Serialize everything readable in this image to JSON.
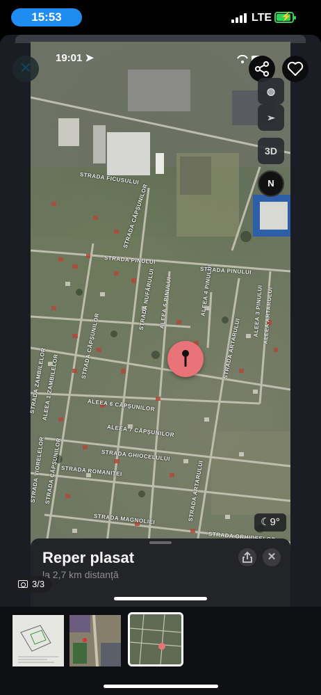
{
  "status_bar": {
    "time": "15:53",
    "carrier": "LTE",
    "battery": "charging"
  },
  "inner_screenshot": {
    "time": "19:01"
  },
  "map": {
    "controls": {
      "globe_icon": "globe-icon",
      "location_icon": "location-arrow-icon",
      "view_3d_label": "3D",
      "compass_label": "N"
    },
    "weather": {
      "icon": "moon-icon",
      "temperature": "9°"
    },
    "streets": [
      {
        "key": "ficusului",
        "name": "STRADA FICUSULUI"
      },
      {
        "key": "capsunilor_top",
        "name": "STRADA CĂPȘUNILOR"
      },
      {
        "key": "pinului_left",
        "name": "STRADA PINULUI"
      },
      {
        "key": "pinului_right",
        "name": "STRADA PINULUI"
      },
      {
        "key": "nufarului",
        "name": "STRADA NUFĂRULUI"
      },
      {
        "key": "aleea6pinului",
        "name": "ALEEA 6 PINULUI"
      },
      {
        "key": "aleea4pinului",
        "name": "ALEEA 4 PINULUI"
      },
      {
        "key": "aleea3pinului",
        "name": "ALEEA 3 PINULUI"
      },
      {
        "key": "capsunilor_mid",
        "name": "STRADA CĂPȘUNILOR"
      },
      {
        "key": "aleea6capsunilor",
        "name": "ALEEA 6 CĂPȘUNILOR"
      },
      {
        "key": "aleea7capsunilor",
        "name": "ALEEA 7 CĂPȘUNILOR"
      },
      {
        "key": "ghiocelului",
        "name": "STRADA GHIOCELULUI"
      },
      {
        "key": "romanitei",
        "name": "STRADA ROMANIȚEI"
      },
      {
        "key": "magnoliei",
        "name": "STRADA MAGNOLIEI"
      },
      {
        "key": "orhideelor",
        "name": "STRADA ORHIDEELOR"
      },
      {
        "key": "arinilor_right",
        "name": "STRADA ARTARULUI"
      },
      {
        "key": "arinilor_bottom",
        "name": "STRADA ARTARULUI"
      },
      {
        "key": "capsunilor_bottom",
        "name": "STRADA CĂPȘUNILOR"
      },
      {
        "key": "viorelelor",
        "name": "STRADA VIORELELOR"
      },
      {
        "key": "aleea1zambilelor",
        "name": "ALEEA 1 ZAMBILELOR"
      },
      {
        "key": "zambilelor",
        "name": "STRADA ZAMBILELOR"
      },
      {
        "key": "ararului",
        "name": "ALEEA ARTARULUI"
      }
    ]
  },
  "sheet": {
    "title": "Reper plasat",
    "subtitle": "la 2,7 km distanță"
  },
  "viewer": {
    "counter": "3/3"
  },
  "colors": {
    "time_pill": "#1e8cf0",
    "battery": "#30d158",
    "pin": "#e8747a"
  }
}
